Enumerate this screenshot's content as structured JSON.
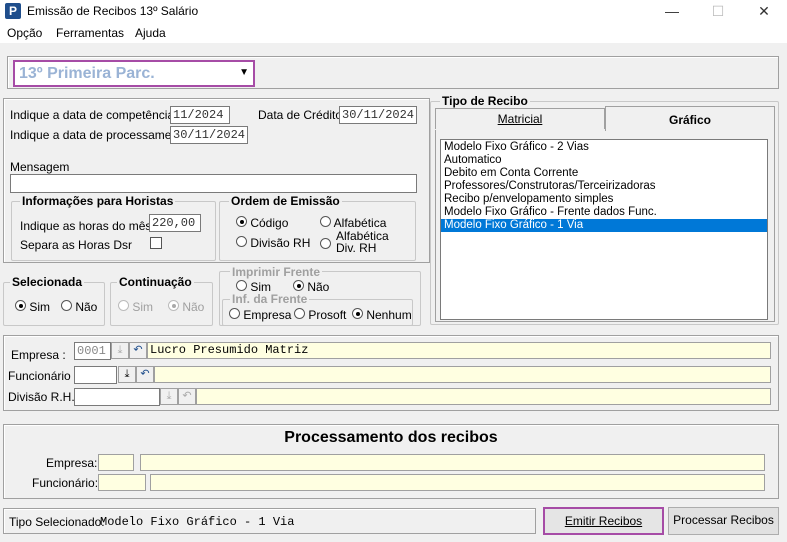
{
  "window": {
    "title": "Emissão de Recibos 13º Salário",
    "app_icon": "P",
    "minimize": "—",
    "maximize": "☐",
    "close": "✕"
  },
  "menu": [
    "Opção",
    "Ferramentas",
    "Ajuda"
  ],
  "parcela": {
    "value": "13º Primeira Parc."
  },
  "datas": {
    "competencia_label": "Indique a data de competência",
    "competencia": "11/2024",
    "credito_label": "Data de Crédito",
    "credito": "30/11/2024",
    "processamento_label": "Indique a data de processamento",
    "processamento": "30/11/2024",
    "mensagem_label": "Mensagem",
    "mensagem": ""
  },
  "horistas": {
    "title": "Informações para Horistas",
    "horas_label": "Indique as horas do mês",
    "horas": "220,00",
    "dsr_label": "Separa as Horas Dsr"
  },
  "ordem": {
    "title": "Ordem de Emissão",
    "codigo": "Código",
    "alfabetica": "Alfabética",
    "divisao": "Divisão RH",
    "alf_div_1": "Alfabética",
    "alf_div_2": "Div.  RH"
  },
  "selecionada": {
    "title": "Selecionada",
    "sim": "Sim",
    "nao": "Não"
  },
  "continuacao": {
    "title": "Continuação",
    "sim": "Sim",
    "nao": "Não"
  },
  "imprimir": {
    "title": "Imprimir Frente",
    "sim": "Sim",
    "nao": "Não",
    "inf_title": "Inf. da Frente",
    "empresa": "Empresa",
    "prosoft": "Prosoft",
    "nenhum": "Nenhum"
  },
  "tipo": {
    "title": "Tipo de Recibo",
    "tabs": [
      "Matricial",
      "Gráfico"
    ],
    "items": [
      "Modelo Fixo Gráfico - 2 Vias",
      "Automatico",
      "Debito em Conta Corrente",
      "Professores/Construtoras/Terceirizadoras",
      "Recibo p/envelopamento simples",
      "Modelo Fixo Gráfico - Frente dados Func.",
      "Modelo Fixo Gráfico - 1 Via"
    ],
    "selected": 6
  },
  "filtros": {
    "empresa_label": "Empresa :",
    "empresa_cod": "0001",
    "empresa_nome": "Lucro Presumido Matriz",
    "func_label": "Funcionário :",
    "divisao_label": "Divisão R.H.:"
  },
  "processamento": {
    "title": "Processamento dos recibos",
    "empresa_label": "Empresa:",
    "func_label": "Funcionário:"
  },
  "status": {
    "label": "Tipo Selecionado:",
    "value": "Modelo Fixo Gráfico - 1 Via"
  },
  "buttons": {
    "emitir": "Emitir Recibos",
    "processar": "Processar Recibos"
  },
  "colors": {
    "accent": "#a64ca6",
    "selection": "#0078d7",
    "combo_text": "#9ab3d5"
  }
}
